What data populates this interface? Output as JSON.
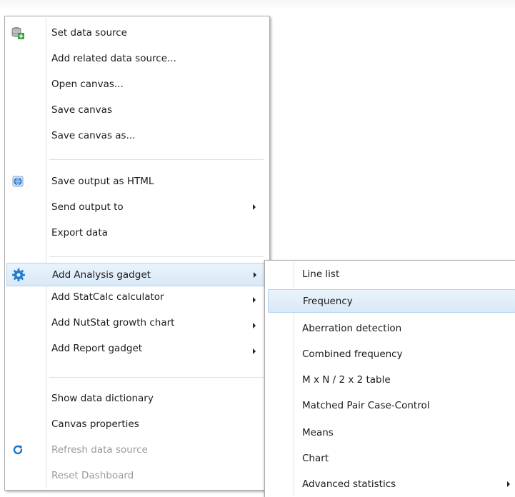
{
  "main_menu": {
    "items": [
      {
        "label": "Set data source",
        "icon": "database-add-icon"
      },
      {
        "label": "Add related data source..."
      },
      {
        "label": "Open canvas..."
      },
      {
        "label": "Save canvas"
      },
      {
        "label": "Save canvas as..."
      },
      {
        "label": "Save output as HTML",
        "icon": "globe-html-icon"
      },
      {
        "label": "Send output to",
        "submenu": true
      },
      {
        "label": "Export data"
      },
      {
        "label": "Add Analysis gadget",
        "icon": "gear-icon",
        "submenu": true,
        "highlighted": true
      },
      {
        "label": "Add StatCalc calculator",
        "submenu": true
      },
      {
        "label": "Add NutStat growth chart",
        "submenu": true
      },
      {
        "label": "Add Report gadget",
        "submenu": true
      },
      {
        "label": "Show data dictionary"
      },
      {
        "label": "Canvas properties"
      },
      {
        "label": "Refresh data source",
        "icon": "refresh-icon",
        "disabled": true
      },
      {
        "label": "Reset Dashboard",
        "disabled": true
      }
    ]
  },
  "sub_menu": {
    "items": [
      {
        "label": "Line list"
      },
      {
        "label": "Frequency",
        "highlighted": true
      },
      {
        "label": "Aberration detection"
      },
      {
        "label": "Combined frequency"
      },
      {
        "label": "M x N / 2 x 2 table"
      },
      {
        "label": "Matched Pair Case-Control"
      },
      {
        "label": "Means"
      },
      {
        "label": "Chart"
      },
      {
        "label": "Advanced statistics",
        "submenu": true
      }
    ]
  },
  "colors": {
    "highlight": "#d9e9f7",
    "highlight_border": "#b5d3ee",
    "disabled_text": "#9a9a9a",
    "icon_blue": "#1a73c9"
  }
}
